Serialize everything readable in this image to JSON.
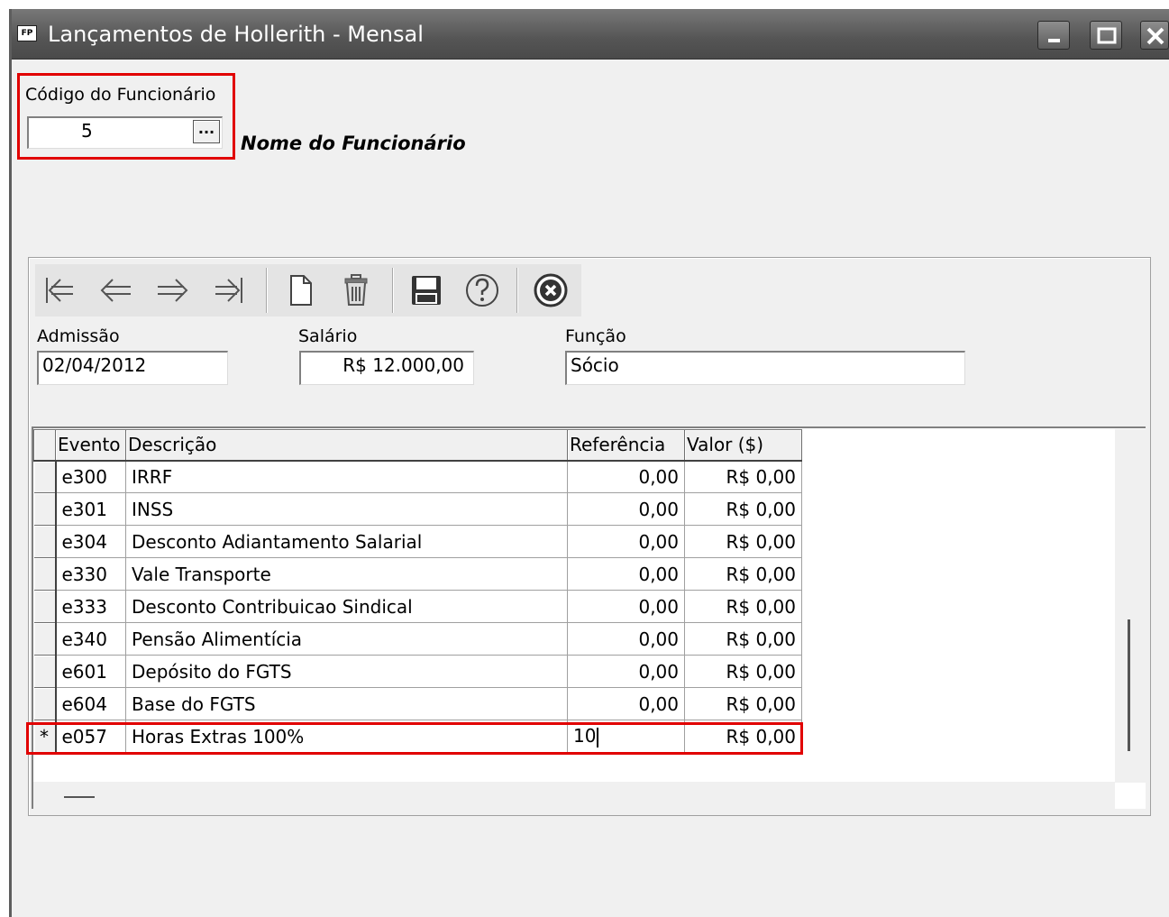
{
  "window": {
    "icon_label": "FP",
    "title": "Lançamentos de Hollerith - Mensal",
    "controls": [
      "minimize-icon",
      "maximize-icon",
      "close-icon"
    ]
  },
  "employee": {
    "code_label": "Código do Funcionário",
    "code_value": "5",
    "lookup_button_label": "...",
    "name_label": "Nome do Funcionário"
  },
  "toolbar": {
    "buttons": [
      "first-record-icon",
      "previous-record-icon",
      "next-record-icon",
      "last-record-icon",
      "new-record-icon",
      "delete-icon",
      "save-icon",
      "help-icon",
      "cancel-icon"
    ]
  },
  "details": {
    "admissao_label": "Admissão",
    "admissao_value": "02/04/2012",
    "salario_label": "Salário",
    "salario_value": "R$ 12.000,00",
    "funcao_label": "Função",
    "funcao_value": "Sócio"
  },
  "grid": {
    "columns": [
      "Evento",
      "Descrição",
      "Referência",
      "Valor ($)"
    ],
    "rows": [
      {
        "indicator": "",
        "evento": "e300",
        "descricao": "IRRF",
        "referencia": "0,00",
        "valor": "R$ 0,00"
      },
      {
        "indicator": "",
        "evento": "e301",
        "descricao": "INSS",
        "referencia": "0,00",
        "valor": "R$ 0,00"
      },
      {
        "indicator": "",
        "evento": "e304",
        "descricao": "Desconto Adiantamento Salarial",
        "referencia": "0,00",
        "valor": "R$ 0,00"
      },
      {
        "indicator": "",
        "evento": "e330",
        "descricao": "Vale Transporte",
        "referencia": "0,00",
        "valor": "R$ 0,00"
      },
      {
        "indicator": "",
        "evento": "e333",
        "descricao": "Desconto Contribuicao Sindical",
        "referencia": "0,00",
        "valor": "R$ 0,00"
      },
      {
        "indicator": "",
        "evento": "e340",
        "descricao": "Pensão Alimentícia",
        "referencia": "0,00",
        "valor": "R$ 0,00"
      },
      {
        "indicator": "",
        "evento": "e601",
        "descricao": "Depósito do FGTS",
        "referencia": "0,00",
        "valor": "R$ 0,00"
      },
      {
        "indicator": "",
        "evento": "e604",
        "descricao": "Base do FGTS",
        "referencia": "0,00",
        "valor": "R$ 0,00"
      }
    ],
    "new_row": {
      "indicator": "*",
      "evento": "e057",
      "descricao": "Horas Extras 100%",
      "referencia": "10",
      "valor": "R$ 0,00"
    }
  },
  "colors": {
    "highlight": "#e10000",
    "titlebar": "#555555",
    "panel": "#f0f0f0"
  }
}
